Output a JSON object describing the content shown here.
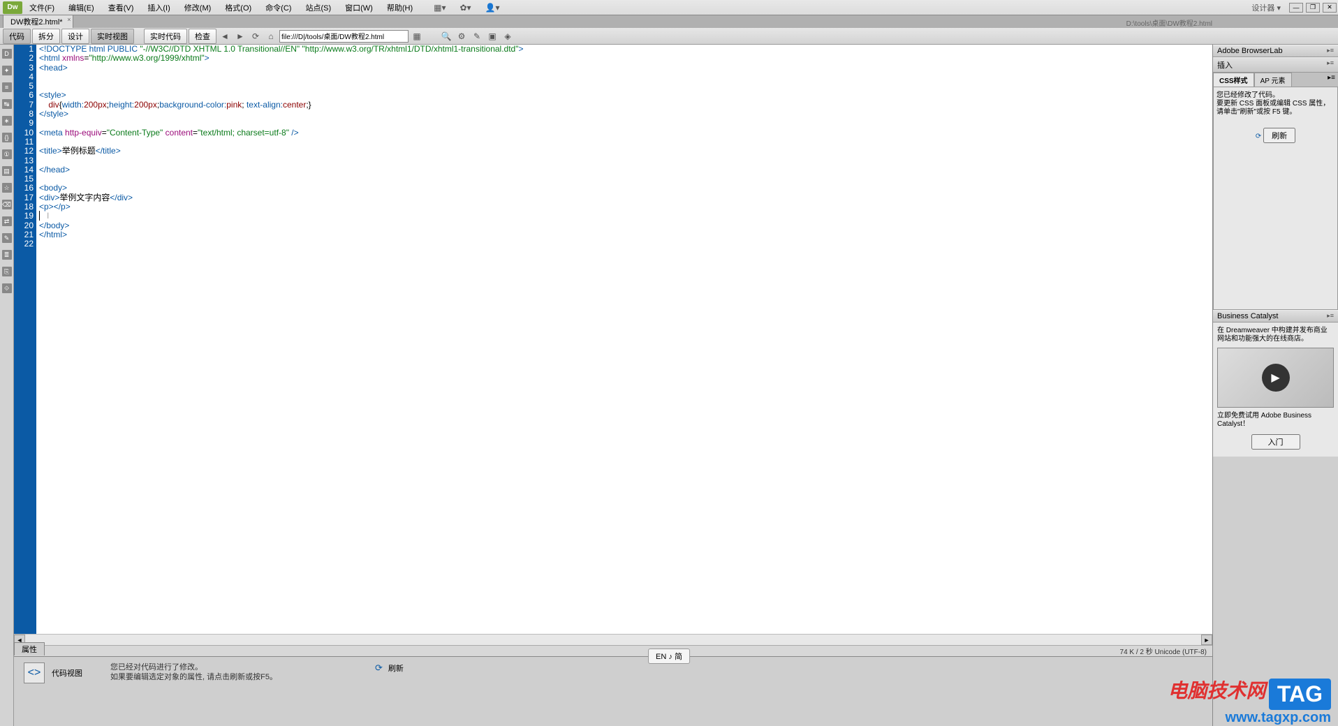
{
  "menubar": {
    "logo": "Dw",
    "items": [
      "文件(F)",
      "编辑(E)",
      "查看(V)",
      "插入(I)",
      "修改(M)",
      "格式(O)",
      "命令(C)",
      "站点(S)",
      "窗口(W)",
      "帮助(H)"
    ],
    "right_label": "设计器"
  },
  "doctab": {
    "filename": "DW教程2.html*",
    "path": "D:\\tools\\桌面\\DW教程2.html"
  },
  "viewbar": {
    "buttons": [
      "代码",
      "拆分",
      "设计",
      "实时视图"
    ],
    "live_code": "实时代码",
    "inspect": "检查",
    "address": "file:///D|/tools/桌面/DW教程2.html"
  },
  "code": {
    "lines": [
      {
        "n": 1,
        "html": "<span class='tag'>&lt;!DOCTYPE html PUBLIC</span> <span class='str'>\"-//W3C//DTD XHTML 1.0 Transitional//EN\"</span> <span class='str'>\"http://www.w3.org/TR/xhtml1/DTD/xhtml1-transitional.dtd\"</span><span class='tag'>&gt;</span>"
      },
      {
        "n": 2,
        "html": "<span class='tag'>&lt;html</span> <span class='attr'>xmlns</span>=<span class='str'>\"http://www.w3.org/1999/xhtml\"</span><span class='tag'>&gt;</span>"
      },
      {
        "n": 3,
        "html": "<span class='tag'>&lt;head&gt;</span>"
      },
      {
        "n": 4,
        "html": ""
      },
      {
        "n": 5,
        "html": ""
      },
      {
        "n": 6,
        "html": "<span class='tag'>&lt;style&gt;</span>"
      },
      {
        "n": 7,
        "html": "    <span class='p-red'>div</span>{<span class='tag'>width:</span><span class='p-red'>200px</span>;<span class='tag'>height:</span><span class='p-red'>200px</span>;<span class='tag'>background-color:</span><span class='p-red'>pink</span>; <span class='tag'>text-align:</span><span class='p-red'>center</span>;}"
      },
      {
        "n": 8,
        "html": "<span class='tag'>&lt;/style&gt;</span>"
      },
      {
        "n": 9,
        "html": ""
      },
      {
        "n": 10,
        "html": "<span class='tag'>&lt;meta</span> <span class='attr'>http-equiv</span>=<span class='str'>\"Content-Type\"</span> <span class='attr'>content</span>=<span class='str'>\"text/html; charset=utf-8\"</span> <span class='tag'>/&gt;</span>"
      },
      {
        "n": 11,
        "html": ""
      },
      {
        "n": 12,
        "html": "<span class='tag'>&lt;title&gt;</span><span class='txt'>举例标题</span><span class='tag'>&lt;/title&gt;</span>"
      },
      {
        "n": 13,
        "html": ""
      },
      {
        "n": 14,
        "html": "<span class='tag'>&lt;/head&gt;</span>"
      },
      {
        "n": 15,
        "html": ""
      },
      {
        "n": 16,
        "html": "<span class='tag'>&lt;body&gt;</span>"
      },
      {
        "n": 17,
        "html": "<span class='tag'>&lt;div&gt;</span><span class='txt'>举例文字内容</span><span class='tag'>&lt;/div&gt;</span>"
      },
      {
        "n": 18,
        "html": "<span class='tag'>&lt;p&gt;&lt;/p&gt;</span>"
      },
      {
        "n": 19,
        "html": "<span class='cursor'></span>   <span style='color:#aaa'>I</span>"
      },
      {
        "n": 20,
        "html": "<span class='tag'>&lt;/body&gt;</span>"
      },
      {
        "n": 21,
        "html": "<span class='tag'>&lt;/html&gt;</span>"
      },
      {
        "n": 22,
        "html": ""
      }
    ]
  },
  "status": "74 K / 2 秒 Unicode (UTF-8)",
  "props": {
    "tab": "属性",
    "title": "代码视图",
    "line1": "您已经对代码进行了修改。",
    "line2": "如果要编辑选定对象的属性, 请点击刷新或按F5。",
    "refresh": "刷新"
  },
  "ime": "EN ♪ 简",
  "right": {
    "browserlab": "Adobe BrowserLab",
    "insert": "插入",
    "css_tabs": [
      "CSS样式",
      "AP 元素"
    ],
    "css_msg": "您已经修改了代码。\n要更新 CSS 面板或编辑 CSS 属性，请单击\"刷新\"或按 F5 键。",
    "css_refresh": "刷新",
    "bc_title": "Business Catalyst",
    "bc_msg": "在 Dreamweaver 中构建并发布商业网站和功能强大的在线商店。",
    "bc_trial": "立即免费试用 Adobe Business Catalyst！",
    "bc_btn": "入门"
  },
  "watermark": {
    "text": "电脑技术网",
    "tag": "TAG",
    "url": "www.tagxp.com"
  }
}
